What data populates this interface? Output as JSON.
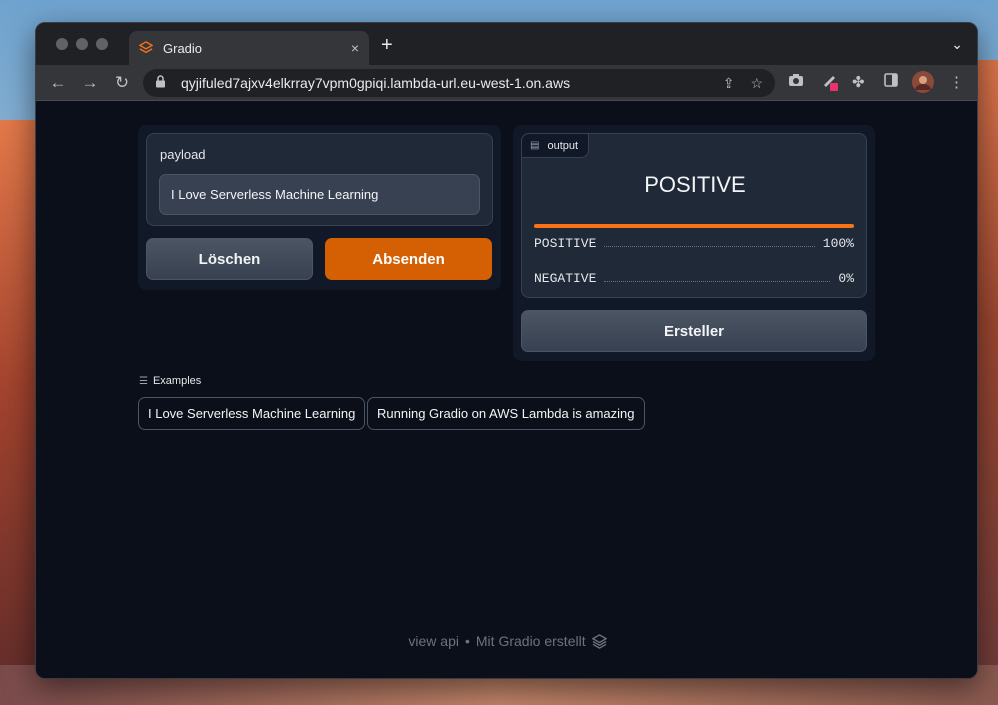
{
  "browser": {
    "tab_title": "Gradio",
    "tab_close": "×",
    "new_tab": "+",
    "url": "qyjifuled7ajxv4elkrray7vpm0gpiqi.lambda-url.eu-west-1.on.aws"
  },
  "icons": {
    "back": "←",
    "forward": "→",
    "reload": "↻",
    "lock": "🔒",
    "share": "⇪",
    "star": "☆",
    "camera": "📷",
    "pen": "✎",
    "puzzle": "✤",
    "sidepanel": "▯",
    "menu": "⋮",
    "tabmenu": "⌄",
    "output_tag": "▤",
    "examples_tag": "☰"
  },
  "input": {
    "label": "payload",
    "value": "I Love Serverless Machine Learning"
  },
  "buttons": {
    "clear": "Löschen",
    "submit": "Absenden",
    "flag": "Ersteller"
  },
  "output": {
    "tag": "output",
    "label": "POSITIVE",
    "confidences": [
      {
        "label": "POSITIVE",
        "value": "100%",
        "fraction": 1.0
      },
      {
        "label": "NEGATIVE",
        "value": "0%",
        "fraction": 0.0
      }
    ]
  },
  "examples": {
    "heading": "Examples",
    "items": [
      "I Love Serverless Machine Learning",
      "Running Gradio on AWS Lambda is amazing"
    ]
  },
  "footer": {
    "api": "view api",
    "sep": "•",
    "built": "Mit Gradio erstellt"
  },
  "colors": {
    "accent": "#d56004",
    "bar": "#f97316",
    "background": "#0b0f19"
  }
}
